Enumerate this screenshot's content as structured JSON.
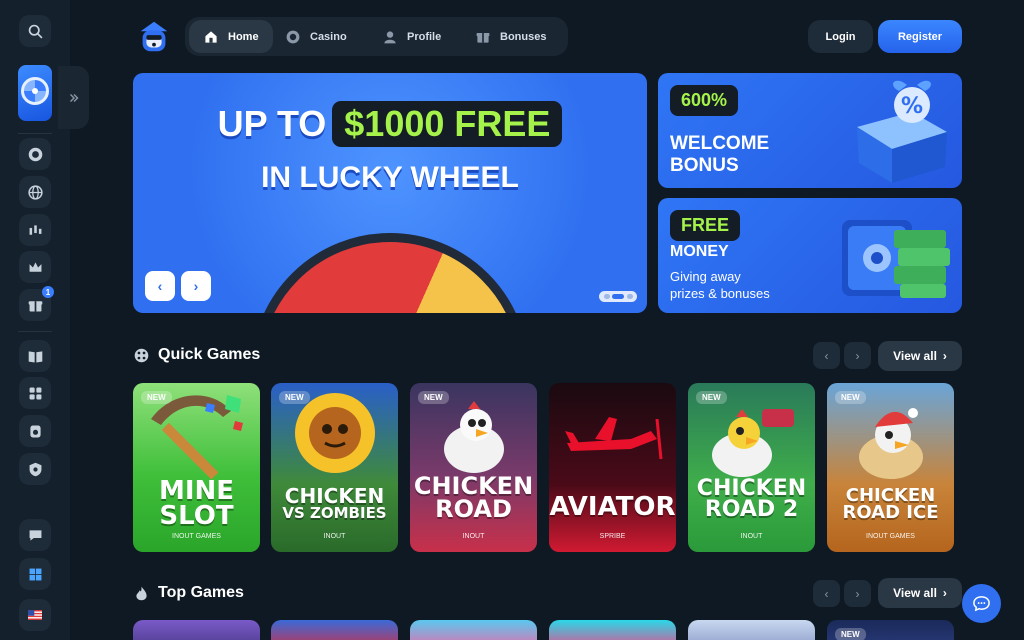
{
  "nav": {
    "items": [
      {
        "label": "Home",
        "icon": "home-icon",
        "active": true
      },
      {
        "label": "Casino",
        "icon": "chip-icon",
        "active": false
      },
      {
        "label": "Profile",
        "icon": "user-icon",
        "active": false
      },
      {
        "label": "Bonuses",
        "icon": "gift-icon",
        "active": false
      }
    ]
  },
  "auth": {
    "login": "Login",
    "register": "Register"
  },
  "sidebar": {
    "badge": "1"
  },
  "hero": {
    "lead": "UP TO",
    "highlight": "$1000 FREE",
    "line2": "IN LUCKY WHEEL"
  },
  "promos": [
    {
      "pill": "600%",
      "title_1": "WELCOME",
      "title_2": "BONUS"
    },
    {
      "pill": "FREE",
      "title_1": "MONEY",
      "sub_1": "Giving away",
      "sub_2": "prizes & bonuses"
    }
  ],
  "quick_games": {
    "title": "Quick Games",
    "view_all": "View all",
    "cards": [
      {
        "new": "NEW",
        "title_1": "MINE",
        "title_2": "SLOT",
        "provider": "INOUT GAMES"
      },
      {
        "new": "NEW",
        "title_1": "CHICKEN",
        "title_2": "VS ZOMBIES",
        "provider": "INOUT"
      },
      {
        "new": "NEW",
        "title_1": "CHICKEN",
        "title_2": "ROAD",
        "provider": "INOUT"
      },
      {
        "new": "",
        "title_1": "AVIATOR",
        "title_2": "",
        "provider": "SPRIBE"
      },
      {
        "new": "NEW",
        "title_1": "CHICKEN",
        "title_2": "ROAD 2",
        "provider": "INOUT"
      },
      {
        "new": "NEW",
        "title_1": "CHICKEN",
        "title_2": "ROAD ICE",
        "provider": "INOUT GAMES"
      }
    ]
  },
  "top_games": {
    "title": "Top Games",
    "view_all": "View all",
    "new": "NEW"
  },
  "colors": {
    "accent": "#2f6ff0",
    "highlight": "#a5f34a",
    "bg": "#0f1923"
  }
}
